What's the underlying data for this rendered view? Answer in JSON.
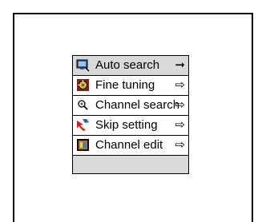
{
  "menu": {
    "items": [
      {
        "label": "Auto search",
        "icon": "antenna-monitor-icon",
        "arrow": "➞",
        "arrow_style": "solid"
      },
      {
        "label": "Fine tuning",
        "icon": "fine-tuning-dial-icon",
        "arrow": "⇨",
        "arrow_style": "outline"
      },
      {
        "label": "Channel search",
        "icon": "magnifier-icon",
        "arrow": "⇨",
        "arrow_style": "outline"
      },
      {
        "label": "Skip setting",
        "icon": "skip-arrow-icon",
        "arrow": "⇨",
        "arrow_style": "outline"
      },
      {
        "label": "Channel edit",
        "icon": "film-edit-icon",
        "arrow": "⇨",
        "arrow_style": "outline"
      }
    ],
    "highlight_color": "#d9d9d9"
  }
}
